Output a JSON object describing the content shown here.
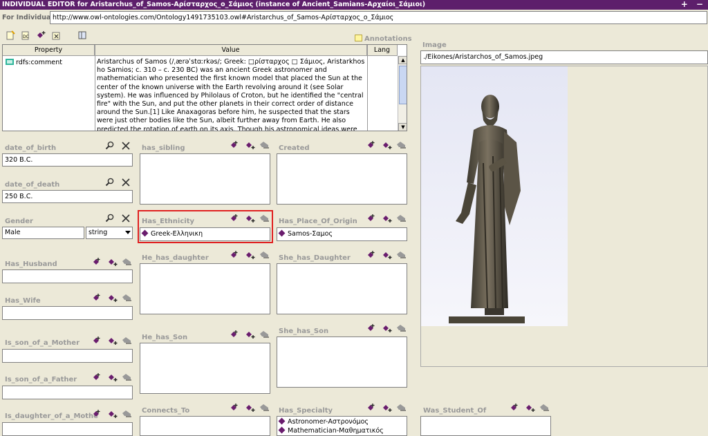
{
  "window": {
    "title": "INDIVIDUAL EDITOR for Aristarchus_of_Samos-Αρίσταρχος_ο_Σάμιος   (instance of Ancient_Samians-Αρχαίοι_Σάμιοι)",
    "controls": "+ −"
  },
  "individual": {
    "label": "For Individual:",
    "uri": "http://www.owl-ontologies.com/Ontology1491735103.owl#Aristarchus_of_Samos-Αρίσταρχος_ο_Σάμιος"
  },
  "annotations": {
    "label": "Annotations",
    "headers": [
      "Property",
      "Value",
      "Lang"
    ],
    "property": "rdfs:comment",
    "comment": "Aristarchus of Samos (/ˌærəˈstɑːrkəs/; Greek: □ρίσταρχος □ Σάμιος, Aristarkhos ho Samios; c. 310 – c. 230 BC) was an ancient Greek astronomer and mathematician who presented the first known model that placed the Sun at the center of the known universe with the Earth revolving around it (see Solar system). He was influenced by Philolaus of Croton, but he identified the \"central fire\" with the Sun, and put the other planets in their correct order of distance around the Sun.[1] Like Anaxagoras before him, he suspected that the stars were just other bodies like the Sun, albeit further away from Earth. He also predicted the rotation of earth on its axis. Though his astronomical ideas were often"
  },
  "image": {
    "label": "Image",
    "path": "./Eikones/Aristarchos_of_Samos.jpeg"
  },
  "slots": {
    "date_of_birth": {
      "label": "date_of_birth",
      "value": "320 B.C."
    },
    "date_of_death": {
      "label": "date_of_death",
      "value": "250 B.C."
    },
    "gender": {
      "label": "Gender",
      "value": "Male",
      "type": "string"
    },
    "has_husband": {
      "label": "Has_Husband"
    },
    "has_wife": {
      "label": "Has_Wife"
    },
    "is_son_of_a_mother": {
      "label": "Is_son_of_a_Mother"
    },
    "is_son_of_a_father": {
      "label": "Is_son_of_a_Father"
    },
    "is_daughter_of_a_mother": {
      "label": "Is_daughter_of_a_Mothe"
    },
    "has_sibling": {
      "label": "has_sibling"
    },
    "has_ethnicity": {
      "label": "Has_Ethnicity",
      "items": [
        "Greek-Ελληνικη"
      ]
    },
    "he_has_daughter": {
      "label": "He_has_daughter"
    },
    "he_has_son": {
      "label": "He_has_Son"
    },
    "connects_to": {
      "label": "Connects_To"
    },
    "created": {
      "label": "Created"
    },
    "has_place_of_origin": {
      "label": "Has_Place_Of_Origin",
      "items": [
        "Samos-Σαμος"
      ]
    },
    "she_has_daughter": {
      "label": "She_has_Daughter"
    },
    "she_has_son": {
      "label": "She_has_Son"
    },
    "has_specialty": {
      "label": "Has_Specialty",
      "items": [
        "Astronomer-Αστρονόμος",
        "Mathematician-Μαθηματικός"
      ]
    },
    "was_student_of": {
      "label": "Was_Student_Of"
    }
  },
  "colors": {
    "titlebar": "#5d1f6b",
    "instance_diamond": "#6a1d6e",
    "highlight": "#e02020"
  }
}
